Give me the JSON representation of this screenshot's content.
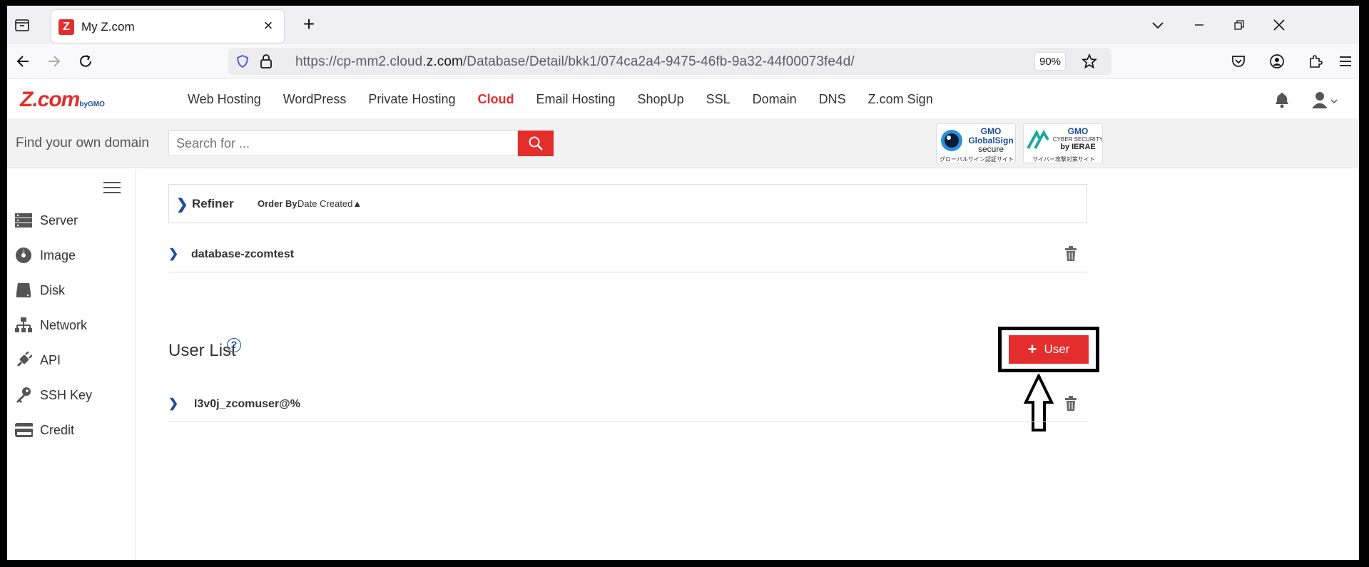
{
  "browser": {
    "tab_title": "My Z.com",
    "url_prefix": "https://cp-mm2.cloud.",
    "url_domain": "z.com",
    "url_path": "/Database/Detail/bkk1/074ca2a4-9475-46fb-9a32-44f00073fe4d/",
    "zoom": "90%"
  },
  "header": {
    "logo_text": "Z.com",
    "logo_sub": "byGMO",
    "nav": [
      "Web Hosting",
      "WordPress",
      "Private Hosting",
      "Cloud",
      "Email Hosting",
      "ShopUp",
      "SSL",
      "Domain",
      "DNS",
      "Z.com Sign"
    ],
    "active_nav": "Cloud"
  },
  "domain_search": {
    "label": "Find your own domain",
    "placeholder": "Search for ..."
  },
  "seals": {
    "globalsign": {
      "line1": "GMO",
      "line2": "GlobalSign",
      "line3": "secure",
      "line4": "グローバルサイン認証サイト"
    },
    "ierae": {
      "line1": "GMO",
      "line2": "CYBER SECURITY",
      "line3": "by IERAE",
      "line4": "サイバー攻撃対策サイト"
    }
  },
  "sidebar": {
    "items": [
      {
        "label": "Server",
        "icon": "server-icon"
      },
      {
        "label": "Image",
        "icon": "image-disc-icon"
      },
      {
        "label": "Disk",
        "icon": "disk-icon"
      },
      {
        "label": "Network",
        "icon": "network-icon"
      },
      {
        "label": "API",
        "icon": "api-plug-icon"
      },
      {
        "label": "SSH Key",
        "icon": "key-icon"
      },
      {
        "label": "Credit",
        "icon": "credit-card-icon"
      }
    ]
  },
  "refiner": {
    "label": "Refiner",
    "order_by_label": "Order By",
    "order_by_value": "Date Created▲"
  },
  "database": {
    "name": "database-zcomtest"
  },
  "user_list": {
    "title": "User List",
    "help": "?",
    "add_button": "User",
    "users": [
      "l3v0j_zcomuser@%"
    ]
  },
  "colors": {
    "brand_red": "#e42d2d",
    "link_blue": "#1d4f9c"
  }
}
